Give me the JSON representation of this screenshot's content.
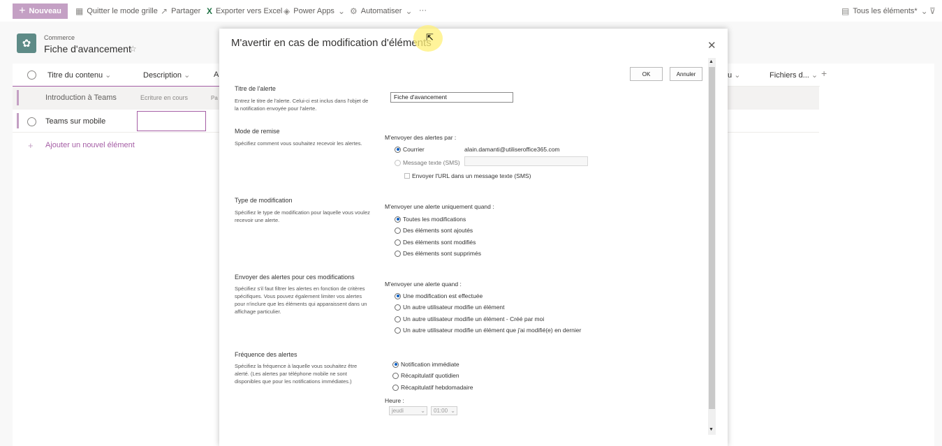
{
  "commandbar": {
    "new_label": "Nouveau",
    "items": [
      {
        "label": "Quitter le mode grille",
        "icon": "grid-icon"
      },
      {
        "label": "Partager",
        "icon": "share-icon"
      },
      {
        "label": "Exporter vers Excel",
        "icon": "excel-icon"
      },
      {
        "label": "Power Apps",
        "icon": "powerapps-icon"
      },
      {
        "label": "Automatiser",
        "icon": "automate-icon"
      }
    ],
    "more": "···",
    "view_selector": "Tous les éléments*"
  },
  "site": {
    "breadcrumb": "Commerce",
    "title": "Fiche d'avancement"
  },
  "list": {
    "columns": [
      "Titre du contenu",
      "Description",
      "A",
      "u",
      "Fichiers d..."
    ],
    "rows": [
      {
        "title": "Introduction à Teams",
        "description": "Ecriture en cours",
        "extra": "Pa"
      },
      {
        "title": "Teams sur mobile",
        "description": "",
        "extra": ""
      }
    ],
    "add_item": "Ajouter un nouvel élément"
  },
  "dialog": {
    "title": "M'avertir en cas de modification d'éléments",
    "ok": "OK",
    "cancel": "Annuler",
    "sections": {
      "alert_title": {
        "title": "Titre de l'alerte",
        "desc": "Entrez le titre de l'alerte. Celui-ci est inclus dans l'objet de la notification envoyée pour l'alerte.",
        "value": "Fiche d'avancement"
      },
      "delivery": {
        "title": "Mode de remise",
        "desc": "Spécifiez comment vous souhaitez recevoir les alertes.",
        "label": "M'envoyer des alertes par :",
        "email_label": "Courrier",
        "email_value": "alain.damanti@utiliseroffice365.com",
        "sms_label": "Message texte (SMS)",
        "sms_url_label": "Envoyer l'URL dans un message texte (SMS)"
      },
      "change_type": {
        "title": "Type de modification",
        "desc": "Spécifiez le type de modification pour laquelle vous voulez recevoir une alerte.",
        "label": "M'envoyer une alerte uniquement quand :",
        "options": [
          "Toutes les modifications",
          "Des éléments sont ajoutés",
          "Des éléments sont modifiés",
          "Des éléments sont supprimés"
        ],
        "selected": 0
      },
      "filter": {
        "title": "Envoyer des alertes pour ces modifications",
        "desc": "Spécifiez s'il faut filtrer les alertes en fonction de critères spécifiques. Vous pouvez également limiter vos alertes pour n'inclure que les éléments qui apparaissent dans un affichage particulier.",
        "label": "M'envoyer une alerte quand :",
        "options": [
          "Une modification est effectuée",
          "Un autre utilisateur modifie un élément",
          "Un autre utilisateur modifie un élément - Créé par moi",
          "Un autre utilisateur modifie un élément que j'ai modifié(e) en dernier"
        ],
        "selected": 0
      },
      "frequency": {
        "title": "Fréquence des alertes",
        "desc": "Spécifiez la fréquence à laquelle vous souhaitez être alerté. (Les alertes par téléphone mobile ne sont disponibles que pour les notifications immédiates.)",
        "options": [
          "Notification immédiate",
          "Récapitulatif quotidien",
          "Récapitulatif hebdomadaire"
        ],
        "selected": 0,
        "time_label": "Heure :",
        "day_value": "jeudi",
        "time_value": "01:00"
      }
    }
  }
}
